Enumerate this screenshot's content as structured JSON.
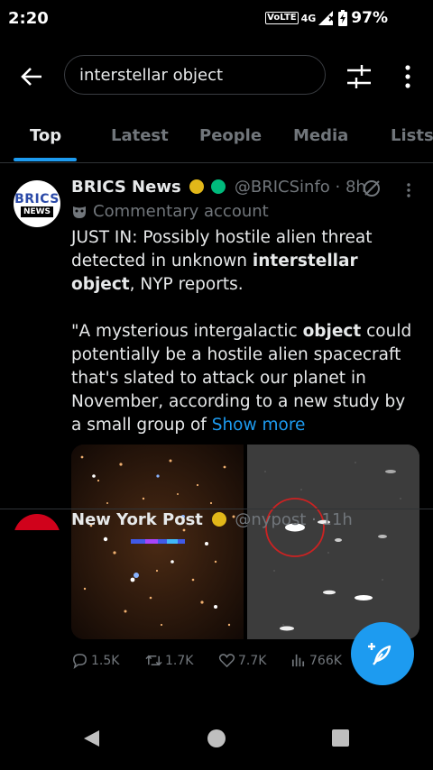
{
  "status_bar": {
    "time": "2:20",
    "volte": "VoLTE",
    "network": "4G",
    "battery": "97%"
  },
  "search": {
    "query": "interstellar object"
  },
  "tabs": [
    {
      "label": "Top",
      "active": true
    },
    {
      "label": "Latest"
    },
    {
      "label": "People"
    },
    {
      "label": "Media"
    },
    {
      "label": "Lists"
    }
  ],
  "tweet": {
    "avatar_text_top": "BRICS",
    "avatar_text_bottom": "NEWS",
    "display_name": "BRICS News",
    "handle": "@BRICSinfo",
    "time": "· 8h",
    "label": "Commentary account",
    "body_p1_a": "JUST IN: Possibly hostile alien threat detected in unknown ",
    "body_p1_hl": "interstellar object",
    "body_p1_b": ", NYP reports.",
    "body_p2_a": "\"A mysterious intergalactic ",
    "body_p2_hl": "object",
    "body_p2_b": " could potentially be a hostile alien spacecraft that's slated to attack our planet in November, according to a new study by a small group of ",
    "show_more": "Show more",
    "replies": "1.5K",
    "reposts": "1.7K",
    "likes": "7.7K",
    "views": "766K"
  },
  "tweet2": {
    "display_name": "New York Post",
    "handle": "@nypost",
    "time": "· 11h"
  },
  "colors": {
    "accent": "#1d9bf0",
    "gold_badge": "#e2b719",
    "muted": "#71767b"
  }
}
